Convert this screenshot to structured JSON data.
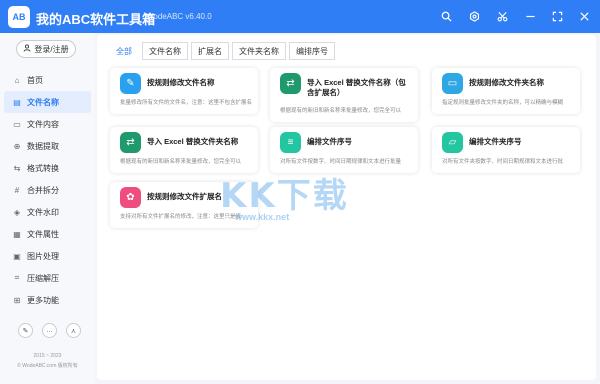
{
  "app": {
    "logo_text": "AB",
    "title": "我的ABC软件工具箱",
    "version": "WodeABC v6.40.0",
    "colors": {
      "brand": "#2f7ef5",
      "active_bg": "#e3edfd"
    }
  },
  "titlebar_icons": [
    "search-icon",
    "settings-icon",
    "scissors-icon",
    "minimize-icon",
    "maximize-icon",
    "close-icon"
  ],
  "sidebar": {
    "login_label": "登录/注册",
    "items": [
      {
        "label": "首页",
        "icon": "home-icon",
        "glyph": "⌂",
        "active": false
      },
      {
        "label": "文件名称",
        "icon": "document-icon",
        "glyph": "▤",
        "active": true
      },
      {
        "label": "文件内容",
        "icon": "content-icon",
        "glyph": "▭",
        "active": false
      },
      {
        "label": "数据提取",
        "icon": "extract-icon",
        "glyph": "⊕",
        "active": false
      },
      {
        "label": "格式转换",
        "icon": "convert-icon",
        "glyph": "⇆",
        "active": false
      },
      {
        "label": "合并拆分",
        "icon": "merge-icon",
        "glyph": "#",
        "active": false
      },
      {
        "label": "文件水印",
        "icon": "watermark-icon",
        "glyph": "◈",
        "active": false
      },
      {
        "label": "文件属性",
        "icon": "properties-icon",
        "glyph": "▦",
        "active": false
      },
      {
        "label": "图片处理",
        "icon": "image-icon",
        "glyph": "▣",
        "active": false
      },
      {
        "label": "压缩解压",
        "icon": "compress-icon",
        "glyph": "⌗",
        "active": false
      },
      {
        "label": "更多功能",
        "icon": "more-icon",
        "glyph": "⊞",
        "active": false
      }
    ],
    "tools": [
      "feedback-icon",
      "chat-icon",
      "share-icon"
    ],
    "copyright_years": "2015 ~ 2023",
    "copyright_owner": "© WodeABC.com 版权所有"
  },
  "tabs": [
    {
      "label": "全部",
      "active": true
    },
    {
      "label": "文件名称",
      "active": false
    },
    {
      "label": "扩展名",
      "active": false
    },
    {
      "label": "文件夹名称",
      "active": false
    },
    {
      "label": "编排序号",
      "active": false
    }
  ],
  "cards": [
    {
      "title": "按规则修改文件名称",
      "desc": "批量修改所有文件的文件名，注意：这里不包含扩展名",
      "icon": "rename-icon",
      "color": "#29a1ee"
    },
    {
      "title": "导入 Excel 替换文件名称（包含扩展名）",
      "desc": "根据现有的新旧和新名称来批量修改，您完全可以",
      "icon": "excel-icon",
      "color": "#1f9a6c"
    },
    {
      "title": "按规则修改文件夹名称",
      "desc": "指定规则批量修改文件夹的名称，可以精确与模糊",
      "icon": "folder-icon",
      "color": "#2fa7e4"
    },
    {
      "title": "导入 Excel 替换文件夹名称",
      "desc": "根据现有的新旧和新名称来批量修改，您完全可以",
      "icon": "excel-icon",
      "color": "#1f9a6c"
    },
    {
      "title": "编排文件序号",
      "desc": "对所有文件按数字、时间日期规律和文本进行批量",
      "icon": "numbering-icon",
      "color": "#23c6a0"
    },
    {
      "title": "编排文件夹序号",
      "desc": "对所有文件夹按数字、时间日期规律和文本进行批",
      "icon": "folder-numbering-icon",
      "color": "#23c6a0"
    },
    {
      "title": "按规则修改文件扩展名",
      "desc": "支持对所有文件扩展名的修改，注意：这里只是修",
      "icon": "extension-icon",
      "color": "#ee4d7d"
    }
  ],
  "watermark": {
    "text": "KK下载",
    "url": "www.kkx.net"
  }
}
